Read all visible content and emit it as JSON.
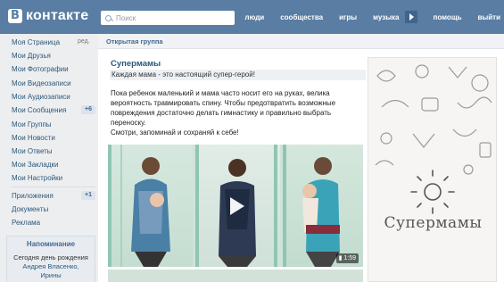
{
  "header": {
    "logo_letter": "В",
    "logo_text": "контакте",
    "search_placeholder": "Поиск",
    "nav": [
      "люди",
      "сообщества",
      "игры",
      "музыка",
      "помощь",
      "выйти"
    ]
  },
  "sidebar": {
    "items": [
      {
        "label": "Моя Страница"
      },
      {
        "label": "Мои Друзья"
      },
      {
        "label": "Мои Фотографии"
      },
      {
        "label": "Мои Видеозаписи"
      },
      {
        "label": "Мои Аудиозаписи"
      },
      {
        "label": "Мои Сообщения",
        "badge": "+6"
      },
      {
        "label": "Мои Группы"
      },
      {
        "label": "Мои Новости"
      },
      {
        "label": "Мои Ответы"
      },
      {
        "label": "Мои Закладки"
      },
      {
        "label": "Мои Настройки"
      }
    ],
    "edit_label": "ред.",
    "extra_items": [
      {
        "label": "Приложения",
        "badge": "+1"
      },
      {
        "label": "Документы"
      },
      {
        "label": "Реклама"
      }
    ],
    "reminder": {
      "title": "Напоминание",
      "text_prefix": "Сегодня день рождения",
      "names": "Андрея Власенко, Ирины"
    }
  },
  "main": {
    "group_label": "Открытая группа",
    "post_title": "Супермамы",
    "post_subtitle": "Каждая мама - это настоящий супер-герой!",
    "post_body": "Пока ребенок маленький и мама часто носит его на руках, велика вероятность травмировать спину. Чтобы предотвратить возможные повреждения достаточно делать гимнастику и правильно выбрать переноску.",
    "post_body_2": "Смотри, запоминай и сохраняй к себе!",
    "video_duration": "1:59",
    "cover_name": "Супермамы"
  },
  "colors": {
    "header_bg": "#597da3",
    "link": "#2b587a",
    "badge_bg": "#dce3eb",
    "video_stripe": "#8fc6b2"
  }
}
